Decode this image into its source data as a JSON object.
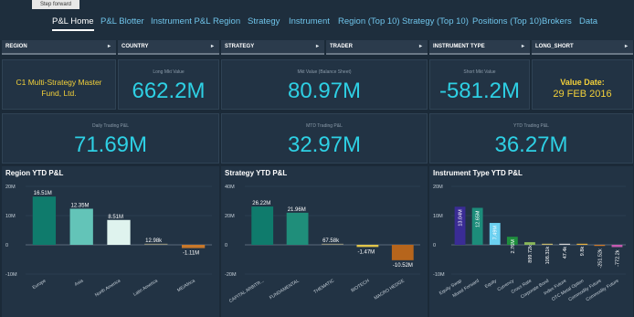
{
  "step_label": "Step forward",
  "nav": {
    "tabs": [
      {
        "label": "P&L Home",
        "active": true
      },
      {
        "label": "P&L Blotter"
      },
      {
        "label": "Instrument P&L"
      },
      {
        "label": "Region"
      },
      {
        "label": "Strategy"
      },
      {
        "label": "Instrument"
      },
      {
        "label": "Region (Top 10)"
      },
      {
        "label": "Strategy (Top 10)"
      },
      {
        "label": "Positions (Top 10)"
      },
      {
        "label": "Brokers"
      },
      {
        "label": "Data"
      }
    ]
  },
  "filters": [
    "REGION",
    "COUNTRY",
    "STRATEGY",
    "TRADER",
    "INSTRUMENT TYPE",
    "LONG_SHORT"
  ],
  "fund_name": "C1 Multi-Strategy Master Fund, Ltd.",
  "kpis": {
    "long_label": "Long Mkt Value",
    "long_value": "662.2M",
    "mkt_label": "Mkt Value (Balance Sheet)",
    "mkt_value": "80.97M",
    "short_label": "Short Mkt Value",
    "short_value": "-581.2M",
    "date_label": "Value Date:",
    "date_value": "29 FEB 2016",
    "daily_label": "Daily Trading P&L",
    "daily_value": "71.69M",
    "mtd_label": "MTD Trading P&L",
    "mtd_value": "32.97M",
    "ytd_label": "YTD Trading P&L",
    "ytd_value": "36.27M"
  },
  "chart_titles": [
    "Region YTD P&L",
    "Strategy YTD P&L",
    "Instrument Type YTD P&L"
  ],
  "chart_data": [
    {
      "type": "bar",
      "title": "Region YTD P&L",
      "ylim": [
        -10,
        20
      ],
      "ticks": [
        {
          "v": 20,
          "l": "20M"
        },
        {
          "v": 10,
          "l": "10M"
        },
        {
          "v": 0,
          "l": "0"
        },
        {
          "v": -10,
          "l": "-10M"
        }
      ],
      "categories": [
        "Europe",
        "Asia",
        "North America",
        "Latin America",
        "ME/Africa"
      ],
      "values": [
        16.51,
        12.35,
        8.51,
        0.013,
        -1.11
      ],
      "labels": [
        "16.51M",
        "12.35M",
        "8.51M",
        "12.98k",
        "-1.11M"
      ],
      "colors": [
        "#0f7b6c",
        "#63c4b8",
        "#dff3ee",
        "#8d8d7a",
        "#c8782a"
      ]
    },
    {
      "type": "bar",
      "title": "Strategy YTD P&L",
      "ylim": [
        -20,
        40
      ],
      "ticks": [
        {
          "v": 40,
          "l": "40M"
        },
        {
          "v": 20,
          "l": "20M"
        },
        {
          "v": 0,
          "l": "0"
        },
        {
          "v": -20,
          "l": "-20M"
        }
      ],
      "categories": [
        "CAPITAL ARBITR...",
        "FUNDAMENTAL",
        "THEMATIC",
        "BIOTECH",
        "MACRO HEDGE"
      ],
      "values": [
        26.22,
        21.96,
        0.068,
        -1.47,
        -10.52
      ],
      "labels": [
        "26.22M",
        "21.96M",
        "67.58k",
        "-1.47M",
        "-10.52M"
      ],
      "colors": [
        "#0f7b6c",
        "#1f8e7a",
        "#8d8d7a",
        "#e2c64a",
        "#b6651c"
      ]
    },
    {
      "type": "bar",
      "title": "Instrument Type YTD P&L",
      "ylim": [
        -10,
        20
      ],
      "ticks": [
        {
          "v": 20,
          "l": "20M"
        },
        {
          "v": 10,
          "l": "10M"
        },
        {
          "v": 0,
          "l": "0"
        },
        {
          "v": -10,
          "l": "-10M"
        }
      ],
      "categories": [
        "Equity Swap",
        "Mixed Forward",
        "Equity",
        "Currency",
        "Cross Rate",
        "Corporate Bond",
        "Index Future",
        "OTC Metal Option",
        "Commodity Future",
        "Commodity Future"
      ],
      "values": [
        13.04,
        12.65,
        7.49,
        2.76,
        0.9,
        0.108,
        0.047,
        0.0098,
        -0.25,
        -0.77
      ],
      "labels": [
        "13.04M",
        "12.65M",
        "7.49M",
        "2.76M",
        "899.72k",
        "108.31k",
        "47.4k",
        "9.8k",
        "-251.52k",
        "-772.2k"
      ],
      "colors": [
        "#3a2c95",
        "#1c8c7a",
        "#6bd0f0",
        "#1f8e3e",
        "#8ab85a",
        "#c7b86e",
        "#d2d2d2",
        "#e6b040",
        "#d07a2a",
        "#c45ab0"
      ]
    }
  ]
}
